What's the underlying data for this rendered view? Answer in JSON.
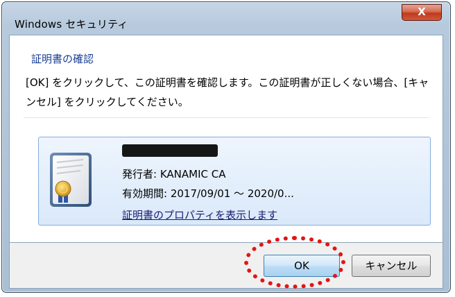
{
  "window": {
    "title": "Windows セキュリティ",
    "close_label": "X"
  },
  "dialog": {
    "heading": "証明書の確認",
    "message": "[OK] をクリックして、この証明書を確認します。この証明書が正しくない場合、[キャンセル] をクリックしてください。"
  },
  "certificate": {
    "name": "",
    "issuer": "発行者: KANAMIC CA",
    "validity": "有効期間: 2017/09/01 ～ 2020/0...",
    "properties_link": "証明書のプロパティを表示します"
  },
  "buttons": {
    "ok_label": "OK",
    "cancel_label": "キャンセル"
  },
  "colors": {
    "heading": "#1a3f93",
    "highlight": "#e21515",
    "tile_border": "#84acdd"
  }
}
